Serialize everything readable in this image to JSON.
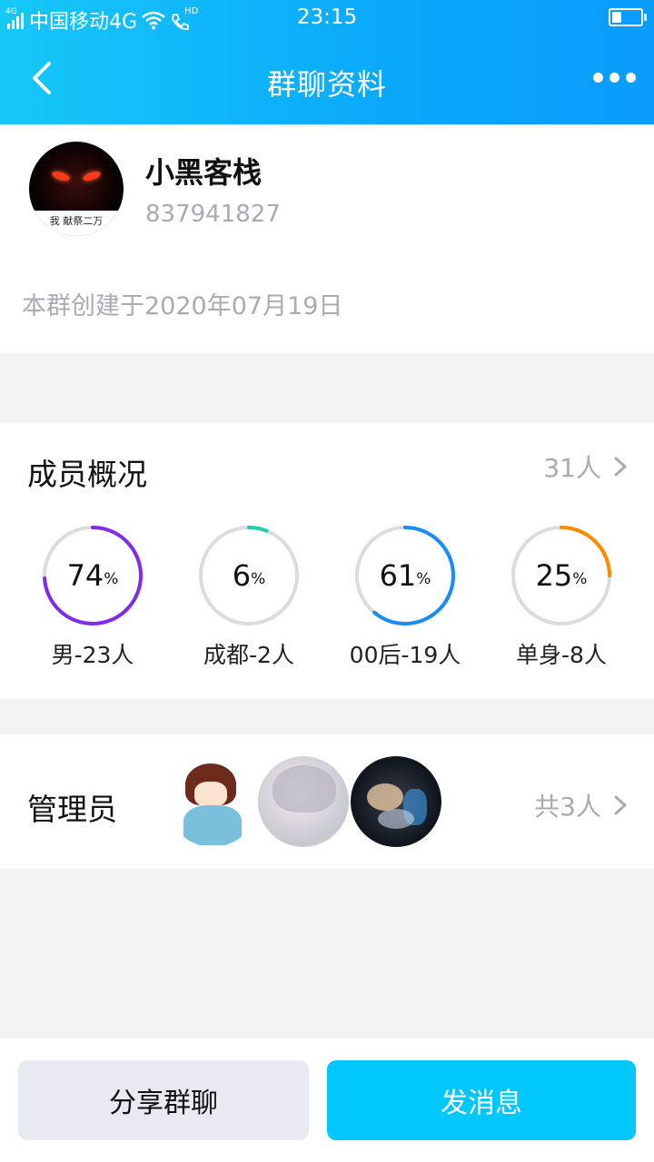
{
  "status_bar": {
    "net_label": "4G",
    "carrier": "中国移动4G",
    "hd_label": "HD",
    "time": "23:15"
  },
  "nav": {
    "title": "群聊资料"
  },
  "group": {
    "name": "小黑客栈",
    "id": "837941827",
    "avatar_caption": "我 献祭二万",
    "created": "本群创建于2020年07月19日"
  },
  "members": {
    "title": "成员概况",
    "count": "31人",
    "stats": [
      {
        "value": "74",
        "unit": "%",
        "label": "男-23人",
        "percent": 74,
        "color": "#7f2bea"
      },
      {
        "value": "6",
        "unit": "%",
        "label": "成都-2人",
        "percent": 6,
        "color": "#1fcfb2"
      },
      {
        "value": "61",
        "unit": "%",
        "label": "00后-19人",
        "percent": 61,
        "color": "#1a8cf5"
      },
      {
        "value": "25",
        "unit": "%",
        "label": "单身-8人",
        "percent": 25,
        "color": "#ff8a00"
      }
    ]
  },
  "admins": {
    "title": "管理员",
    "count": "共3人"
  },
  "buttons": {
    "share": "分享群聊",
    "send": "发消息"
  },
  "colors": {
    "header_start": "#16c8f8",
    "header_end": "#0a9cfb",
    "send_button": "#00c7fc",
    "ring_track": "#dcdcdc"
  }
}
